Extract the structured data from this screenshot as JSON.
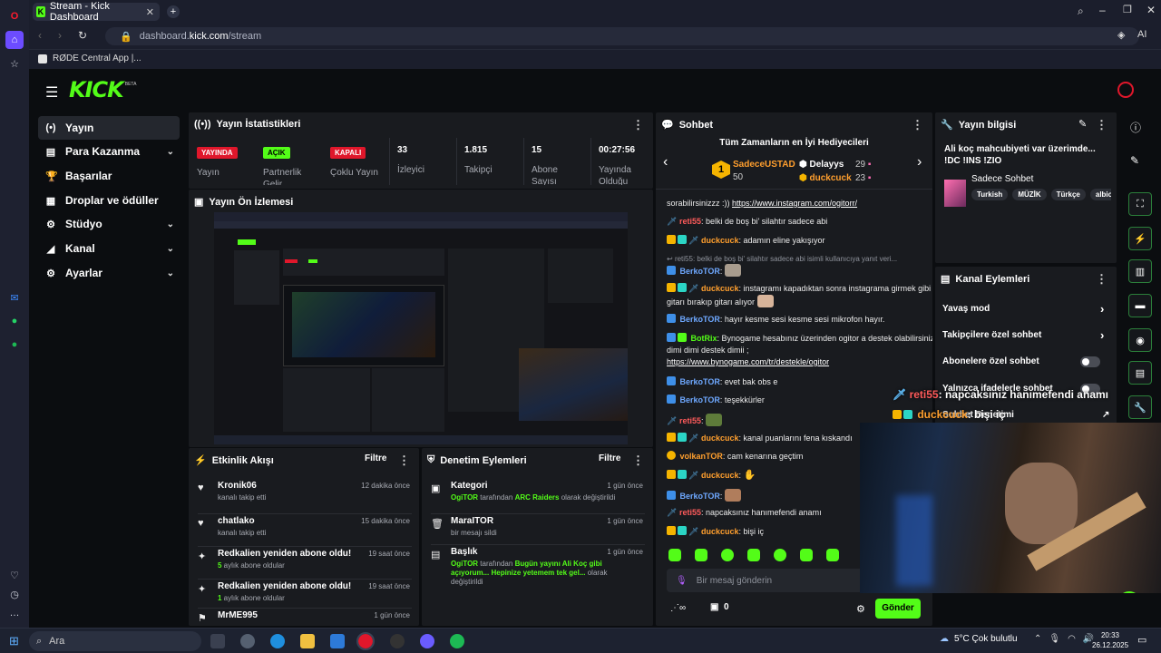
{
  "browser": {
    "tab_title": "Stream - Kick Dashboard",
    "url_prefix": "dashboard.",
    "url_domain": "kick.com",
    "url_path": "/stream",
    "bookmark": "RØDE Central App |..."
  },
  "kick": {
    "logo": "KICK",
    "beta": "BETA"
  },
  "nav": [
    {
      "label": "Yayın",
      "icon": "(•)"
    },
    {
      "label": "Para Kazanma",
      "icon": "▤"
    },
    {
      "label": "Başarılar",
      "icon": "🏆"
    },
    {
      "label": "Droplar ve ödüller",
      "icon": "▦"
    },
    {
      "label": "Stüdyo",
      "icon": "⚙"
    },
    {
      "label": "Kanal",
      "icon": "◢"
    },
    {
      "label": "Ayarlar",
      "icon": "⚙"
    }
  ],
  "stats": {
    "title": "Yayın İstatistikleri",
    "badges": [
      {
        "badge": "YAYINDA",
        "label": "Yayın",
        "color": "#e0172b"
      },
      {
        "badge": "AÇIK",
        "label": "Partnerlik Gelir",
        "color": "#53fc18"
      },
      {
        "badge": "KAPALI",
        "label": "Çoklu Yayın",
        "color": "#e0172b"
      }
    ],
    "numbers": [
      {
        "value": "33",
        "label": "İzleyici"
      },
      {
        "value": "1.815",
        "label": "Takipçi"
      },
      {
        "value": "15",
        "label": "Abone Sayısı"
      },
      {
        "value": "00:27:56",
        "label": "Yayında Olduğu"
      }
    ]
  },
  "preview": {
    "title": "Yayın Ön İzlemesi"
  },
  "activity": {
    "title": "Etkinlik Akışı",
    "filter": "Filtre",
    "items": [
      {
        "title": "Kronik06",
        "sub": "kanalı takip etti",
        "time": "12 dakika önce",
        "icon": "♥"
      },
      {
        "title": "chatlako",
        "sub": "kanalı takip etti",
        "time": "15 dakika önce",
        "icon": "♥"
      },
      {
        "title": "Redkalien yeniden abone oldu!",
        "sub_num": "5",
        "sub": " aylık abone oldular",
        "time": "19 saat önce",
        "icon": "✦"
      },
      {
        "title": "Redkalien yeniden abone oldu!",
        "sub_num": "1",
        "sub": " aylık abone oldular",
        "time": "19 saat önce",
        "icon": "✦"
      },
      {
        "title": "MrME995",
        "sub": "",
        "time": "1 gün önce",
        "icon": "⚑"
      }
    ]
  },
  "moderation": {
    "title": "Denetim Eylemleri",
    "filter": "Filtre",
    "items": [
      {
        "title": "Kategori",
        "time": "1 gün önce",
        "line1_user": "OgiTOR",
        "line1_mid": " tarafından ",
        "line1_val": "ARC Raiders",
        "line1_end": " olarak değiştirildi",
        "icon": "▣"
      },
      {
        "title": "MaraITOR",
        "time": "1 gün önce",
        "line1": "bir mesajı sildi",
        "icon": "🗑"
      },
      {
        "title": "Başlık",
        "time": "1 gün önce",
        "line1_user": "OgiTOR",
        "line1_mid": " tarafından ",
        "line1_val": "Bugün yayını Ali Koç gibi açıyorum... Hepinize yetemem tek gel...",
        "line1_end": " olarak değiştirildi",
        "icon": "▤"
      }
    ]
  },
  "chat": {
    "title": "Sohbet",
    "gifters_title": "Tüm Zamanların en İyi Hediyecileri",
    "gifters": [
      {
        "name": "SadeceUSTAD",
        "count": "50",
        "rank": "1"
      },
      {
        "name": "Delayys",
        "count": "29"
      },
      {
        "name": "duckcuck",
        "count": "23"
      }
    ],
    "messages": [
      {
        "user": "",
        "text": "sorabilirsinizzz :)) ",
        "link": "https://www.instagram.com/ogitorr/"
      },
      {
        "user": "reti55",
        "text": ": belki de boş bi' silahtır sadece abi",
        "color": "#ff5b5b"
      },
      {
        "user": "duckcuck",
        "text": ": adamın eline yakışıyor",
        "color": "#ff9f2e"
      },
      {
        "reply": "reti55: belki de boş bi' silahtır sadece abi isimli kullanıcıya yanıt veri..."
      },
      {
        "user": "BerkoTOR",
        "text": ":",
        "color": "#6ea8ff"
      },
      {
        "user": "duckcuck",
        "text": ": instagramı kapadıktan sonra instagrama girmek gibi gitarı bırakıp gitarı alıyor",
        "color": "#ff9f2e"
      },
      {
        "user": "BerkoTOR",
        "text": ": hayır kesme sesi kesme sesi mikrofon hayır.",
        "color": "#6ea8ff"
      },
      {
        "user": "BotRix",
        "text": ": Bynogame hesabınız üzerinden ogitor a destek olabilirsiniz dimi dimi destek dimii ;",
        "link": "https://www.bynogame.com/tr/destekle/ogitor",
        "color": "#53fc18"
      },
      {
        "user": "BerkoTOR",
        "text": ": evet bak obs e",
        "color": "#6ea8ff"
      },
      {
        "user": "BerkoTOR",
        "text": ": teşekkürler",
        "color": "#6ea8ff"
      },
      {
        "user": "reti55",
        "text": ":",
        "color": "#ff5b5b"
      },
      {
        "user": "duckcuck",
        "text": ": kanal puanlarını fena kıskandı",
        "color": "#ff9f2e"
      },
      {
        "user": "volkanTOR",
        "text": ": cam kenarına geçtim",
        "color": "#ff9f2e"
      },
      {
        "user": "duckcuck",
        "text": ":",
        "color": "#ff9f2e"
      },
      {
        "user": "BerkoTOR",
        "text": ":",
        "color": "#6ea8ff"
      },
      {
        "user": "reti55",
        "text": ": napcaksınız hanımefendi anamı",
        "color": "#ff5b5b"
      },
      {
        "user": "duckcuck",
        "text": ": bişi iç",
        "color": "#ff9f2e"
      }
    ],
    "input_placeholder": "Bir mesaj gönderin",
    "points": "0",
    "send": "Gönder"
  },
  "stream_info": {
    "title": "Yayın bilgisi",
    "stream_title": "Ali koç mahcubiyeti var üzerimde... !DC !INS !ZIO",
    "category": "Sadece Sohbet",
    "tags": [
      "Turkish",
      "MÜZİK",
      "Türkçe",
      "albio"
    ]
  },
  "channel_actions": {
    "title": "Kanal Eylemleri",
    "items": [
      {
        "label": "Yavaş mod",
        "type": "arrow"
      },
      {
        "label": "Takipçilere özel sohbet",
        "type": "arrow"
      },
      {
        "label": "Abonelere özel sohbet",
        "type": "toggle"
      },
      {
        "label": "Yalnızca ifadelerle sohbet",
        "type": "toggle"
      },
      {
        "label": "Sohbet Denetimi",
        "type": "link"
      }
    ]
  },
  "overlay_chat": [
    {
      "user": "reti55",
      "text": ": napcaksınız hanımefendi anamı",
      "color": "#ff5b5b"
    },
    {
      "user": "duckcuck",
      "text": ": bişi iç",
      "color": "#ff9f2e"
    }
  ],
  "taskbar": {
    "search": "Ara",
    "weather": "5°C  Çok bulutlu",
    "time": "20:33",
    "date": "26.12.2025"
  }
}
